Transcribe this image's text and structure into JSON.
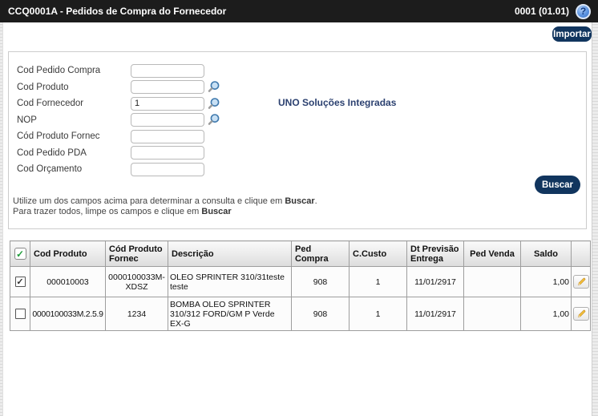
{
  "titlebar": {
    "title": "CCQ0001A - Pedidos de Compra do Fornecedor",
    "version": "0001 (01.01)",
    "help_glyph": "?"
  },
  "toolbar": {
    "importar_label": "Importar"
  },
  "search_panel": {
    "fields": [
      {
        "label": "Cod Pedido Compra",
        "value": "",
        "has_lookup": false
      },
      {
        "label": "Cod Produto",
        "value": "",
        "has_lookup": true
      },
      {
        "label": "Cod Fornecedor",
        "value": "1",
        "has_lookup": true
      },
      {
        "label": "NOP",
        "value": "",
        "has_lookup": true
      },
      {
        "label": "Cód Produto Fornec",
        "value": "",
        "has_lookup": false
      },
      {
        "label": "Cod Pedido PDA",
        "value": "",
        "has_lookup": false
      },
      {
        "label": "Cod Orçamento",
        "value": "",
        "has_lookup": false
      }
    ],
    "brand_text": "UNO Soluções Integradas",
    "buscar_label": "Buscar",
    "hint1_text": "Utilize um dos campos acima para determinar a consulta e clique em ",
    "hint1_bold": "Buscar",
    "hint1_end": ".",
    "hint2_text": "Para trazer todos, limpe os campos e clique em ",
    "hint2_bold": "Buscar"
  },
  "table": {
    "select_all_checked": true,
    "headers": [
      "Cod Produto",
      "Cód Produto Fornec",
      "Descrição",
      "Ped Compra",
      "C.Custo",
      "Dt Previsão Entrega",
      "Ped Venda",
      "Saldo"
    ],
    "rows": [
      {
        "checked": true,
        "cod_produto": "000010003",
        "cod_produto_fornec": "0000100033M-XDSZ",
        "descricao": "OLEO SPRINTER 310/31teste teste",
        "ped_compra": "908",
        "c_custo": "1",
        "dt_previsao_entrega": "11/01/2917",
        "ped_venda": "",
        "saldo": "1,00"
      },
      {
        "checked": false,
        "cod_produto": "0000100033M.2.5.9",
        "cod_produto_fornec": "1234",
        "descricao": "BOMBA OLEO SPRINTER 310/312 FORD/GM P Verde EX-G",
        "ped_compra": "908",
        "c_custo": "1",
        "dt_previsao_entrega": "11/01/2917",
        "ped_venda": "",
        "saldo": "1,00"
      }
    ]
  },
  "icons": {
    "help": "question-mark-icon",
    "lookup": "magnifier-icon",
    "edit": "pencil-icon"
  },
  "colors": {
    "titlebar_bg": "#1c1c1c",
    "accent_navy": "#11355e",
    "brand_text": "#2c4170",
    "select_all_check_green": "#1f9d3a",
    "pencil_yellow": "#f5c33b",
    "help_icon_blue": "#4a86e8"
  }
}
